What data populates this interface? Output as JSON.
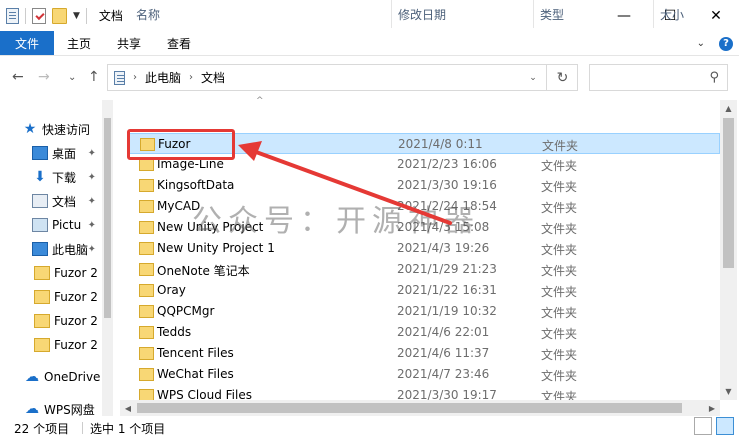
{
  "window": {
    "title": "文档",
    "minimize": "—",
    "maximize": "☐",
    "close": "✕"
  },
  "ribbon": {
    "tabs": [
      "文件",
      "主页",
      "共享",
      "查看"
    ],
    "expand": "⌄",
    "help": "?"
  },
  "address": {
    "back": "←",
    "forward": "→",
    "recent": "⌄",
    "up": "↑",
    "segments": [
      "此电脑",
      "文档"
    ],
    "separator": "›",
    "dropdown": "⌄",
    "refresh": "↻",
    "search_icon": "⚲"
  },
  "nav": {
    "items": [
      {
        "label": "快速访问",
        "icon": "star-icon"
      },
      {
        "label": "桌面",
        "icon": "desktop-icon",
        "pinned": true
      },
      {
        "label": "下载",
        "icon": "download-icon",
        "pinned": true
      },
      {
        "label": "文档",
        "icon": "documents-icon",
        "pinned": true
      },
      {
        "label": "Pictu",
        "icon": "pictures-icon",
        "pinned": true
      },
      {
        "label": "此电脑",
        "icon": "computer-icon",
        "pinned": true
      },
      {
        "label": "Fuzor 2",
        "icon": "folder-icon"
      },
      {
        "label": "Fuzor 2",
        "icon": "folder-icon"
      },
      {
        "label": "Fuzor 2",
        "icon": "folder-icon"
      },
      {
        "label": "Fuzor 2",
        "icon": "folder-icon"
      },
      {
        "label": "OneDrive",
        "icon": "onedrive-icon"
      },
      {
        "label": "WPS网盘",
        "icon": "wps-cloud-icon"
      }
    ],
    "pin_glyph": "📌"
  },
  "list": {
    "columns": [
      "名称",
      "修改日期",
      "类型",
      "大小"
    ],
    "sort_glyph": "^",
    "rows": [
      {
        "name": "Fuzor",
        "date": "2021/4/8 0:11",
        "type": "文件夹",
        "selected": true
      },
      {
        "name": "Image-Line",
        "date": "2021/2/23 16:06",
        "type": "文件夹"
      },
      {
        "name": "KingsoftData",
        "date": "2021/3/30 19:16",
        "type": "文件夹"
      },
      {
        "name": "MyCAD",
        "date": "2021/2/24 18:54",
        "type": "文件夹"
      },
      {
        "name": "New Unity Project",
        "date": "2021/4/3 15:08",
        "type": "文件夹"
      },
      {
        "name": "New Unity Project 1",
        "date": "2021/4/3 19:26",
        "type": "文件夹"
      },
      {
        "name": "OneNote 笔记本",
        "date": "2021/1/29 21:23",
        "type": "文件夹"
      },
      {
        "name": "Oray",
        "date": "2021/1/22 16:31",
        "type": "文件夹"
      },
      {
        "name": "QQPCMgr",
        "date": "2021/1/19 10:32",
        "type": "文件夹"
      },
      {
        "name": "Tedds",
        "date": "2021/4/6 22:01",
        "type": "文件夹"
      },
      {
        "name": "Tencent Files",
        "date": "2021/4/6 11:37",
        "type": "文件夹"
      },
      {
        "name": "WeChat Files",
        "date": "2021/4/7 23:46",
        "type": "文件夹"
      },
      {
        "name": "WPS Cloud Files",
        "date": "2021/3/30 19:17",
        "type": "文件夹"
      }
    ]
  },
  "watermark": "公众号：开源神器",
  "status": {
    "count": "22 个项目",
    "selected": "选中 1 个项目"
  },
  "colors": {
    "accent": "#1a6fc9",
    "selection": "#cce8ff",
    "annotation_red": "#e53935"
  }
}
